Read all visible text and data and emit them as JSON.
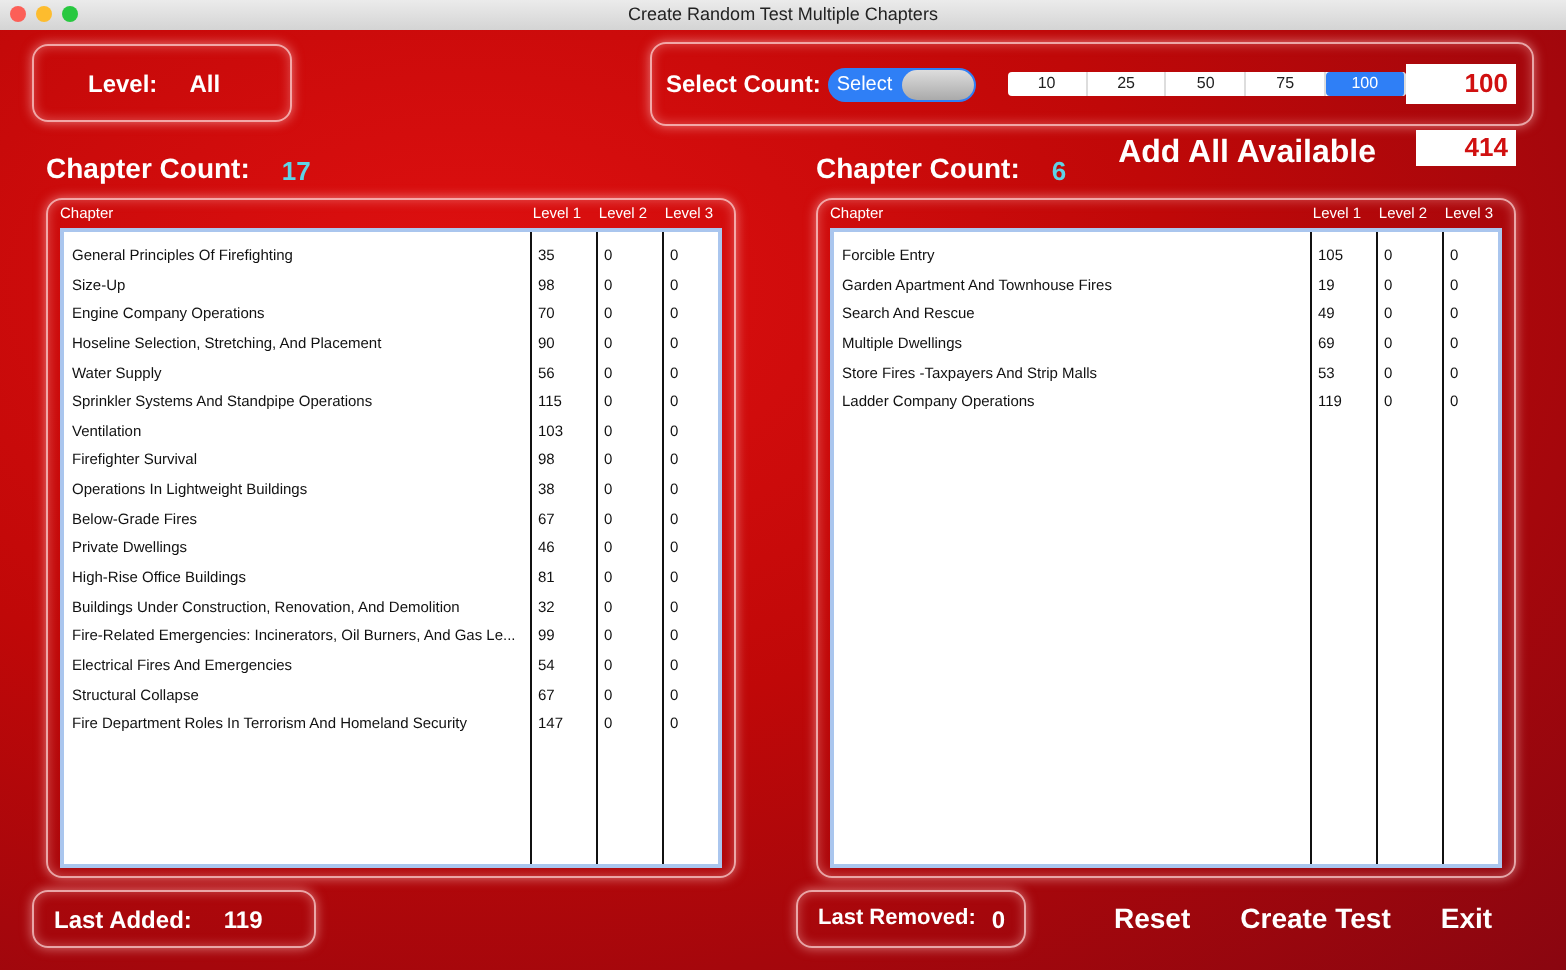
{
  "window": {
    "title": "Create Random Test Multiple Chapters"
  },
  "level": {
    "label": "Level:",
    "value": "All"
  },
  "select_count": {
    "label": "Select Count:",
    "switch": {
      "label": "Select",
      "on": true
    },
    "options": [
      {
        "label": "10",
        "selected": false
      },
      {
        "label": "25",
        "selected": false
      },
      {
        "label": "50",
        "selected": false
      },
      {
        "label": "75",
        "selected": false
      },
      {
        "label": "100",
        "selected": true
      }
    ],
    "value": "100"
  },
  "add_all": {
    "label": "Add All Available",
    "value": "414"
  },
  "available": {
    "count_label": "Chapter Count:",
    "count": "17",
    "columns": [
      "Chapter",
      "Level 1",
      "Level 2",
      "Level 3"
    ],
    "rows": [
      [
        "General Principles Of Firefighting",
        "35",
        "0",
        "0"
      ],
      [
        "Size-Up",
        "98",
        "0",
        "0"
      ],
      [
        "Engine Company Operations",
        "70",
        "0",
        "0"
      ],
      [
        "Hoseline Selection, Stretching, And Placement",
        "90",
        "0",
        "0"
      ],
      [
        "Water Supply",
        "56",
        "0",
        "0"
      ],
      [
        "Sprinkler Systems And Standpipe Operations",
        "115",
        "0",
        "0"
      ],
      [
        "Ventilation",
        "103",
        "0",
        "0"
      ],
      [
        "Firefighter Survival",
        "98",
        "0",
        "0"
      ],
      [
        "Operations In Lightweight Buildings",
        "38",
        "0",
        "0"
      ],
      [
        "Below-Grade Fires",
        "67",
        "0",
        "0"
      ],
      [
        "Private Dwellings",
        "46",
        "0",
        "0"
      ],
      [
        "High-Rise Office Buildings",
        "81",
        "0",
        "0"
      ],
      [
        "Buildings Under Construction, Renovation, And Demolition",
        "32",
        "0",
        "0"
      ],
      [
        "Fire-Related Emergencies: Incinerators, Oil Burners, And Gas Le...",
        "99",
        "0",
        "0"
      ],
      [
        "Electrical Fires And Emergencies",
        "54",
        "0",
        "0"
      ],
      [
        "Structural Collapse",
        "67",
        "0",
        "0"
      ],
      [
        "Fire Department Roles In Terrorism And Homeland Security",
        "147",
        "0",
        "0"
      ]
    ]
  },
  "chosen": {
    "count_label": "Chapter Count:",
    "count": "6",
    "columns": [
      "Chapter",
      "Level 1",
      "Level 2",
      "Level 3"
    ],
    "rows": [
      [
        "Forcible Entry",
        "105",
        "0",
        "0"
      ],
      [
        "Garden Apartment And Townhouse Fires",
        "19",
        "0",
        "0"
      ],
      [
        "Search And Rescue",
        "49",
        "0",
        "0"
      ],
      [
        "Multiple Dwellings",
        "69",
        "0",
        "0"
      ],
      [
        "Store Fires -Taxpayers And Strip Malls",
        "53",
        "0",
        "0"
      ],
      [
        "Ladder Company Operations",
        "119",
        "0",
        "0"
      ]
    ]
  },
  "last_added": {
    "label": "Last Added:",
    "value": "119"
  },
  "last_removed": {
    "label": "Last Removed:",
    "value": "0"
  },
  "buttons": [
    "Reset",
    "Create Test",
    "Exit"
  ]
}
